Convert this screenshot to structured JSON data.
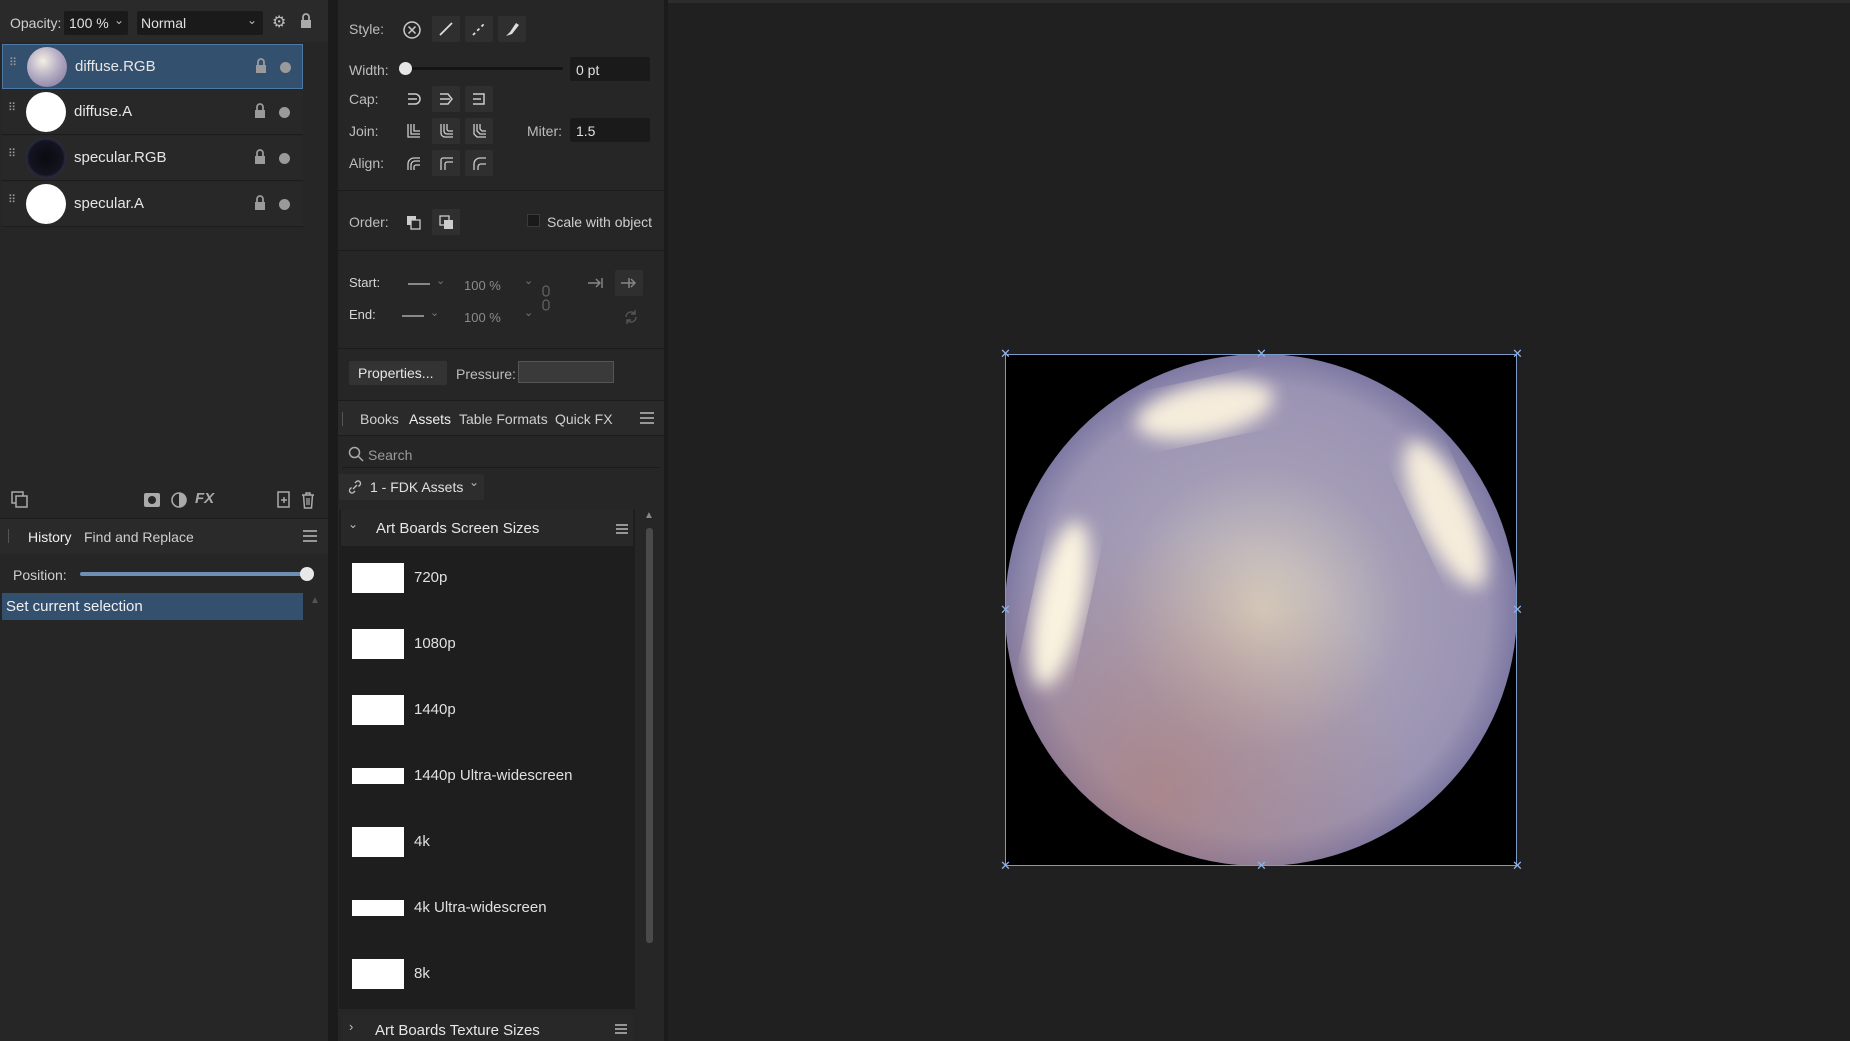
{
  "layers_panel": {
    "opacity_label": "Opacity:",
    "opacity_value": "100 %",
    "blend_mode": "Normal",
    "layers": [
      {
        "name": "diffuse.RGB",
        "selected": true,
        "thumb": "sphere-diffuse"
      },
      {
        "name": "diffuse.A",
        "selected": false,
        "thumb": "white"
      },
      {
        "name": "specular.RGB",
        "selected": false,
        "thumb": "sphere-specular"
      },
      {
        "name": "specular.A",
        "selected": false,
        "thumb": "white"
      }
    ],
    "bottom_icons": [
      "copy-layers-icon",
      "mask-icon",
      "adjustment-icon",
      "fx-icon",
      "add-layer-icon",
      "trash-icon"
    ]
  },
  "history_panel": {
    "tabs": [
      "History",
      "Find and Replace"
    ],
    "active_tab": "History",
    "position_label": "Position:",
    "position_value": 1.0,
    "entries": [
      "Set current selection"
    ]
  },
  "stroke_panel": {
    "style_label": "Style:",
    "width_label": "Width:",
    "width_value": "0 pt",
    "cap_label": "Cap:",
    "join_label": "Join:",
    "miter_label": "Miter:",
    "miter_value": "1.5",
    "align_label": "Align:",
    "order_label": "Order:",
    "scale_with_object": "Scale with object",
    "start_label": "Start:",
    "start_scale": "100 %",
    "end_label": "End:",
    "end_scale": "100 %",
    "properties_button": "Properties...",
    "pressure_label": "Pressure:"
  },
  "assets_panel": {
    "tabs": [
      "Books",
      "Assets",
      "Table Formats",
      "Quick FX"
    ],
    "active_tab": "Assets",
    "search_placeholder": "Search",
    "category": "1 - FDK Assets",
    "group_title": "Art Boards Screen Sizes",
    "items": [
      "720p",
      "1080p",
      "1440p",
      "1440p Ultra-widescreen",
      "4k",
      "4k Ultra-widescreen",
      "8k"
    ],
    "group2_title": "Art Boards Texture Sizes"
  },
  "colors": {
    "selection_blue": "#34506f",
    "accent_handle": "#8fb3e6",
    "panel_bg": "#262626"
  }
}
